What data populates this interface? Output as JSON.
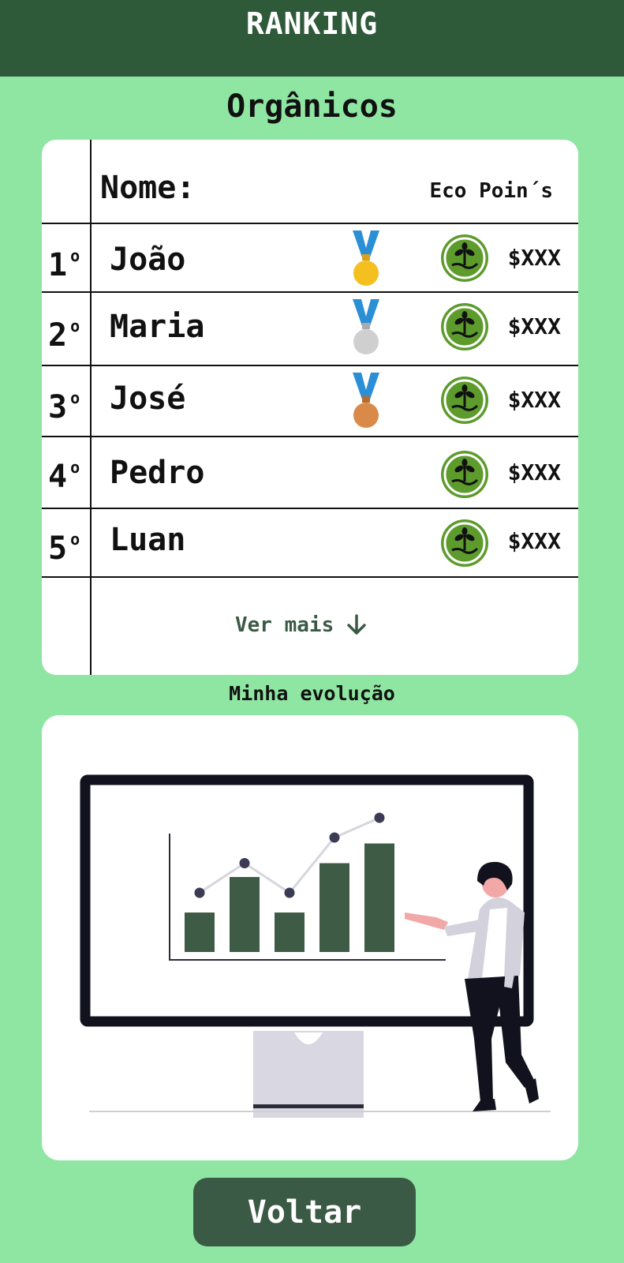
{
  "header": {
    "title": "RANKING"
  },
  "section": {
    "title": "Orgânicos"
  },
  "table": {
    "name_header": "Nome:",
    "points_header": "Eco Poin´s",
    "rows": [
      {
        "rank": "1",
        "ordinal": "o",
        "name": "João",
        "medal": "gold-medal-icon",
        "amount": "$XXX"
      },
      {
        "rank": "2",
        "ordinal": "o",
        "name": "Maria",
        "medal": "silver-medal-icon",
        "amount": "$XXX"
      },
      {
        "rank": "3",
        "ordinal": "o",
        "name": "José",
        "medal": "bronze-medal-icon",
        "amount": "$XXX"
      },
      {
        "rank": "4",
        "ordinal": "o",
        "name": "Pedro",
        "medal": null,
        "amount": "$XXX"
      },
      {
        "rank": "5",
        "ordinal": "o",
        "name": "Luan",
        "medal": null,
        "amount": "$XXX"
      }
    ],
    "see_more": "Ver mais",
    "see_more_icon": "arrow-down-icon"
  },
  "evolution": {
    "title": "Minha evolução",
    "illustration": "person-presenting-chart-illustration",
    "chart_data": {
      "type": "bar",
      "categories": [
        "",
        "",
        "",
        "",
        ""
      ],
      "values": [
        2,
        3.8,
        2,
        4.5,
        5.5
      ],
      "line_values": [
        3,
        4.5,
        3,
        5.8,
        6.8
      ],
      "ylim": [
        0,
        8
      ]
    }
  },
  "footer": {
    "back_label": "Voltar"
  },
  "colors": {
    "header_bg": "#2f5a3a",
    "page_bg": "#8fe6a2",
    "bar": "#3d5b45",
    "button": "#3b5a45",
    "gold": "#f4c020",
    "silver": "#cfcfcf",
    "bronze": "#d98a49",
    "ribbon": "#2b8fd6",
    "coin_green": "#5d9b2d"
  }
}
